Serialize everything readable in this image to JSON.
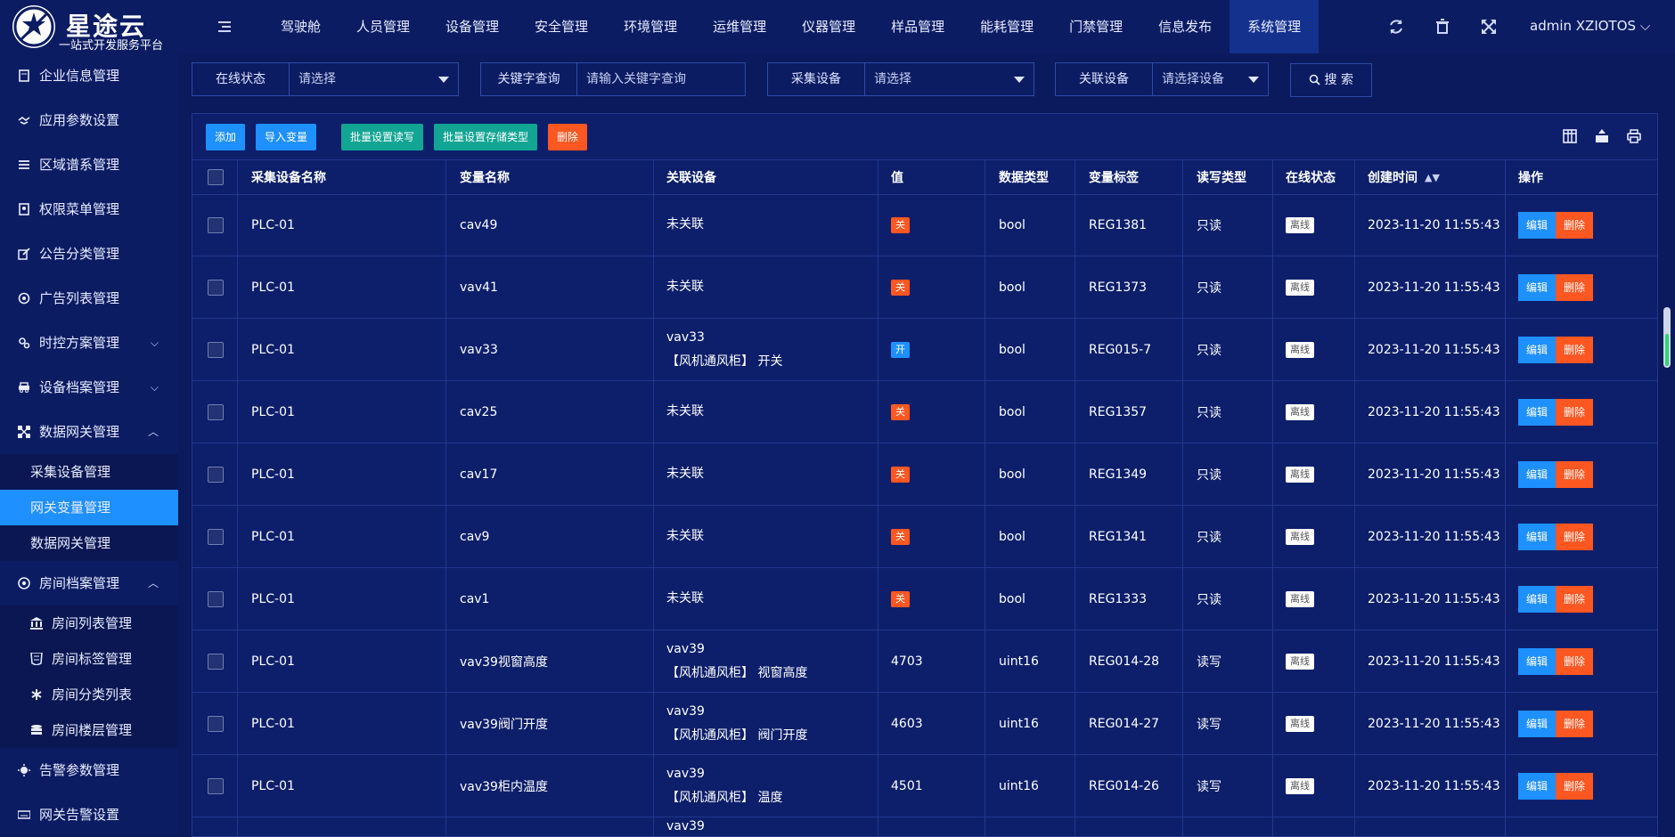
{
  "brand": {
    "title": "星途云",
    "subtitle": "一站式开发服务平台"
  },
  "nav": [
    "驾驶舱",
    "人员管理",
    "设备管理",
    "安全管理",
    "环境管理",
    "运维管理",
    "仪器管理",
    "样品管理",
    "能耗管理",
    "门禁管理",
    "信息发布",
    "系统管理"
  ],
  "user": {
    "name": "admin XZIOTOS",
    "caret": "⌵"
  },
  "sidebar": {
    "top": [
      "企业信息管理",
      "应用参数设置",
      "区域谱系管理",
      "权限菜单管理",
      "公告分类管理",
      "广告列表管理",
      "时控方案管理",
      "设备档案管理",
      "数据网关管理"
    ],
    "gateway_subs": [
      "采集设备管理",
      "网关变量管理",
      "数据网关管理"
    ],
    "room": "房间档案管理",
    "room_subs": [
      "房间列表管理",
      "房间标签管理",
      "房间分类列表",
      "房间楼层管理"
    ],
    "bottom": [
      "告警参数管理",
      "网关告警设置"
    ],
    "chev_down": "⌵",
    "chev_up": "︿"
  },
  "filters": {
    "online": {
      "label": "在线状态",
      "value": "请选择"
    },
    "keyword": {
      "label": "关键字查询",
      "placeholder": "请输入关键字查询"
    },
    "collector": {
      "label": "采集设备",
      "value": "请选择"
    },
    "linked": {
      "label": "关联设备",
      "value": "请选择设备"
    },
    "search": "搜 索"
  },
  "toolbar": {
    "add": "添加",
    "import": "导入变量",
    "batch_rw": "批量设置读写",
    "batch_store": "批量设置存储类型",
    "delete": "删除"
  },
  "table": {
    "headers": [
      "采集设备名称",
      "变量名称",
      "关联设备",
      "值",
      "数据类型",
      "变量标签",
      "读写类型",
      "在线状态",
      "创建时间",
      "操作"
    ],
    "sort_glyph": "▲▼",
    "actions": {
      "edit": "编辑",
      "delete": "删除"
    },
    "rows": [
      {
        "device": "PLC-01",
        "var": "cav49",
        "linked1": "未关联",
        "linked2": "",
        "value": "关",
        "value_kind": "off",
        "dtype": "bool",
        "tag": "REG1381",
        "rw": "只读",
        "status": "离线",
        "time": "2023-11-20 11:55:43"
      },
      {
        "device": "PLC-01",
        "var": "vav41",
        "linked1": "未关联",
        "linked2": "",
        "value": "关",
        "value_kind": "off",
        "dtype": "bool",
        "tag": "REG1373",
        "rw": "只读",
        "status": "离线",
        "time": "2023-11-20 11:55:43"
      },
      {
        "device": "PLC-01",
        "var": "vav33",
        "linked1": "vav33",
        "linked2": "【风机通风柜】 开关",
        "value": "开",
        "value_kind": "on",
        "dtype": "bool",
        "tag": "REG015-7",
        "rw": "只读",
        "status": "离线",
        "time": "2023-11-20 11:55:43"
      },
      {
        "device": "PLC-01",
        "var": "cav25",
        "linked1": "未关联",
        "linked2": "",
        "value": "关",
        "value_kind": "off",
        "dtype": "bool",
        "tag": "REG1357",
        "rw": "只读",
        "status": "离线",
        "time": "2023-11-20 11:55:43"
      },
      {
        "device": "PLC-01",
        "var": "cav17",
        "linked1": "未关联",
        "linked2": "",
        "value": "关",
        "value_kind": "off",
        "dtype": "bool",
        "tag": "REG1349",
        "rw": "只读",
        "status": "离线",
        "time": "2023-11-20 11:55:43"
      },
      {
        "device": "PLC-01",
        "var": "cav9",
        "linked1": "未关联",
        "linked2": "",
        "value": "关",
        "value_kind": "off",
        "dtype": "bool",
        "tag": "REG1341",
        "rw": "只读",
        "status": "离线",
        "time": "2023-11-20 11:55:43"
      },
      {
        "device": "PLC-01",
        "var": "cav1",
        "linked1": "未关联",
        "linked2": "",
        "value": "关",
        "value_kind": "off",
        "dtype": "bool",
        "tag": "REG1333",
        "rw": "只读",
        "status": "离线",
        "time": "2023-11-20 11:55:43"
      },
      {
        "device": "PLC-01",
        "var": "vav39视窗高度",
        "linked1": "vav39",
        "linked2": "【风机通风柜】 视窗高度",
        "value": "4703",
        "value_kind": "text",
        "dtype": "uint16",
        "tag": "REG014-28",
        "rw": "读写",
        "status": "离线",
        "time": "2023-11-20 11:55:43"
      },
      {
        "device": "PLC-01",
        "var": "vav39阀门开度",
        "linked1": "vav39",
        "linked2": "【风机通风柜】 阀门开度",
        "value": "4603",
        "value_kind": "text",
        "dtype": "uint16",
        "tag": "REG014-27",
        "rw": "读写",
        "status": "离线",
        "time": "2023-11-20 11:55:43"
      },
      {
        "device": "PLC-01",
        "var": "vav39柜内温度",
        "linked1": "vav39",
        "linked2": "【风机通风柜】 温度",
        "value": "4501",
        "value_kind": "text",
        "dtype": "uint16",
        "tag": "REG014-26",
        "rw": "读写",
        "status": "离线",
        "time": "2023-11-20 11:55:43"
      },
      {
        "device": "",
        "var": "",
        "linked1": "vav39",
        "linked2": "",
        "value": "",
        "value_kind": "text",
        "dtype": "",
        "tag": "",
        "rw": "",
        "status": "",
        "time": ""
      }
    ]
  }
}
